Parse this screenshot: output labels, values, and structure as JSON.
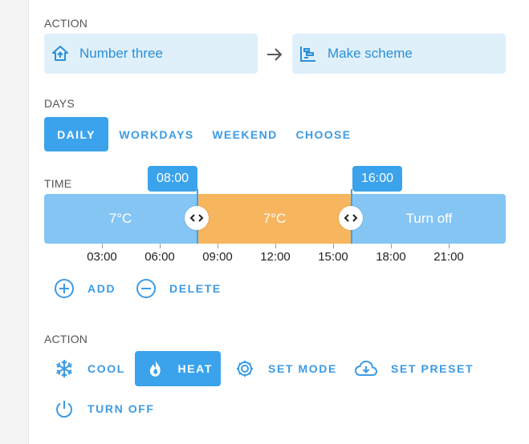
{
  "action_section": {
    "label": "ACTION",
    "from_entity": "Number three",
    "to_entity": "Make scheme"
  },
  "days_section": {
    "label": "DAYS",
    "options": [
      "DAILY",
      "WORKDAYS",
      "WEEKEND",
      "CHOOSE"
    ],
    "selected": "DAILY"
  },
  "time_section": {
    "label": "TIME",
    "segments": [
      "7°C",
      "7°C",
      "Turn off"
    ],
    "markers": [
      "08:00",
      "16:00"
    ],
    "ticks": [
      "03:00",
      "06:00",
      "09:00",
      "12:00",
      "15:00",
      "18:00",
      "21:00"
    ],
    "add_label": "ADD",
    "delete_label": "DELETE"
  },
  "mode_section": {
    "label": "ACTION",
    "cool": "COOL",
    "heat": "HEAT",
    "set_mode": "SET MODE",
    "set_preset": "SET PRESET",
    "turn_off": "TURN OFF",
    "selected": "HEAT"
  },
  "colors": {
    "accent": "#3ba3ec",
    "segment_blue": "#84c5f4",
    "segment_orange": "#f7b55e",
    "entity_bg": "#dff0fb"
  },
  "icons": {
    "from_entity": "home-export-icon",
    "to_entity": "chart-timeline-icon",
    "arrow": "arrow-right-icon"
  }
}
